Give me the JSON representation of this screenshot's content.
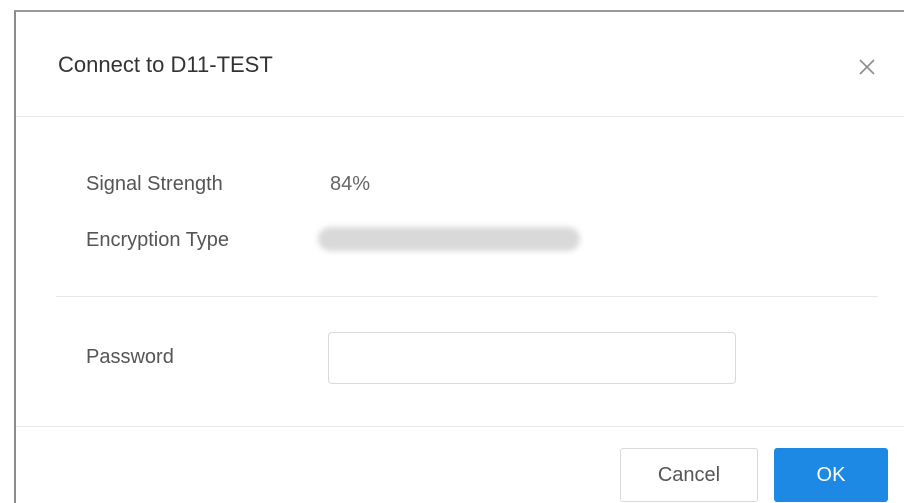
{
  "dialog": {
    "title": "Connect to D11-TEST",
    "close_icon": "close-icon"
  },
  "info": {
    "signal_label": "Signal Strength",
    "signal_value": "84%",
    "encryption_label": "Encryption Type"
  },
  "password": {
    "label": "Password",
    "value": "",
    "placeholder": ""
  },
  "buttons": {
    "cancel_label": "Cancel",
    "ok_label": "OK"
  },
  "colors": {
    "primary": "#1e88e5",
    "border": "#d9d9d9",
    "text": "#333333"
  }
}
